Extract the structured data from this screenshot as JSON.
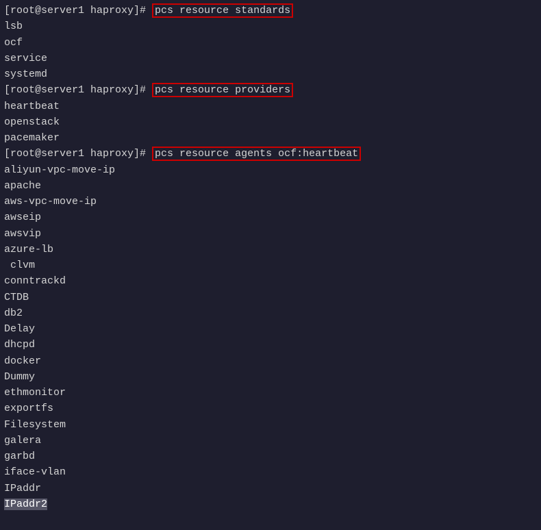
{
  "terminal": {
    "lines": [
      {
        "type": "prompt-cmd",
        "prompt": "[root@server1 haproxy]# ",
        "command": "pcs resource standards"
      },
      {
        "type": "output",
        "text": "lsb"
      },
      {
        "type": "output",
        "text": "ocf"
      },
      {
        "type": "output",
        "text": "service"
      },
      {
        "type": "output",
        "text": "systemd"
      },
      {
        "type": "prompt-cmd",
        "prompt": "[root@server1 haproxy]# ",
        "command": "pcs resource providers"
      },
      {
        "type": "output",
        "text": "heartbeat"
      },
      {
        "type": "output",
        "text": "openstack"
      },
      {
        "type": "output",
        "text": "pacemaker"
      },
      {
        "type": "prompt-cmd",
        "prompt": "[root@server1 haproxy]# ",
        "command": "pcs resource agents ocf:heartbeat"
      },
      {
        "type": "output",
        "text": "aliyun-vpc-move-ip"
      },
      {
        "type": "output",
        "text": "apache"
      },
      {
        "type": "output",
        "text": "aws-vpc-move-ip"
      },
      {
        "type": "output",
        "text": "awseip"
      },
      {
        "type": "output",
        "text": "awsvip"
      },
      {
        "type": "output",
        "text": "azure-lb"
      },
      {
        "type": "output",
        "text": " clvm"
      },
      {
        "type": "output",
        "text": "conntrackd"
      },
      {
        "type": "output",
        "text": "CTDB"
      },
      {
        "type": "output",
        "text": "db2"
      },
      {
        "type": "output",
        "text": "Delay"
      },
      {
        "type": "output",
        "text": "dhcpd"
      },
      {
        "type": "output",
        "text": "docker"
      },
      {
        "type": "output",
        "text": "Dummy"
      },
      {
        "type": "output",
        "text": "ethmonitor"
      },
      {
        "type": "output",
        "text": "exportfs"
      },
      {
        "type": "output",
        "text": "Filesystem"
      },
      {
        "type": "output",
        "text": "galera"
      },
      {
        "type": "output",
        "text": "garbd"
      },
      {
        "type": "output",
        "text": "iface-vlan"
      },
      {
        "type": "output",
        "text": "IPaddr"
      },
      {
        "type": "output-selected",
        "text": "IPaddr2"
      }
    ]
  }
}
